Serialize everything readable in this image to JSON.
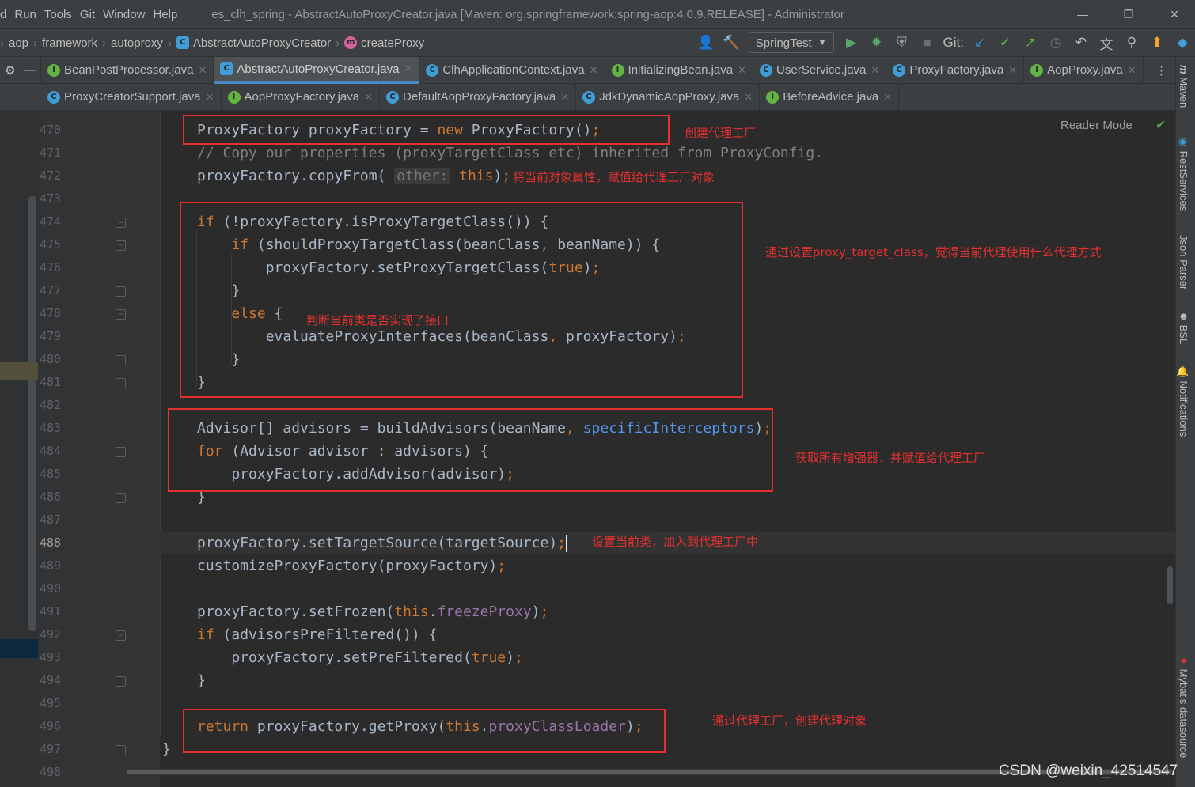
{
  "menu": {
    "items": [
      "d",
      "Run",
      "Tools",
      "Git",
      "Window",
      "Help"
    ],
    "title": "es_clh_spring - AbstractAutoProxyCreator.java [Maven: org.springframework:spring-aop:4.0.9.RELEASE] - Administrator"
  },
  "breadcrumb": {
    "items": [
      "aop",
      "framework",
      "autoproxy",
      "AbstractAutoProxyCreator",
      "createProxy"
    ]
  },
  "toolbar": {
    "run_config": "SpringTest",
    "git_label": "Git:"
  },
  "tabs_row1": [
    {
      "label": "BeanPostProcessor.java",
      "icon": "I"
    },
    {
      "label": "AbstractAutoProxyCreator.java",
      "icon": "C",
      "active": true
    },
    {
      "label": "ClhApplicationContext.java",
      "icon": "C"
    },
    {
      "label": "InitializingBean.java",
      "icon": "I"
    },
    {
      "label": "UserService.java",
      "icon": "C"
    },
    {
      "label": "ProxyFactory.java",
      "icon": "C"
    },
    {
      "label": "AopProxy.java",
      "icon": "I"
    }
  ],
  "tabs_row2": [
    {
      "label": "ProxyCreatorSupport.java",
      "icon": "C"
    },
    {
      "label": "AopProxyFactory.java",
      "icon": "I"
    },
    {
      "label": "DefaultAopProxyFactory.java",
      "icon": "C"
    },
    {
      "label": "JdkDynamicAopProxy.java",
      "icon": "C"
    },
    {
      "label": "BeforeAdvice.java",
      "icon": "I"
    }
  ],
  "editor": {
    "reader_mode": "Reader Mode",
    "line_numbers": [
      "470",
      "471",
      "472",
      "473",
      "474",
      "475",
      "476",
      "477",
      "478",
      "479",
      "480",
      "481",
      "482",
      "483",
      "484",
      "485",
      "486",
      "487",
      "488",
      "489",
      "490",
      "491",
      "492",
      "493",
      "494",
      "495",
      "496",
      "497",
      "498"
    ],
    "hint_other": "other:"
  },
  "annotations": {
    "n1": "创建代理工厂",
    "n2": "将当前对象属性，赋值给代理工厂对象",
    "n3": "通过设置proxy_target_class，觉得当前代理使用什么代理方式",
    "n4": "判断当前类是否实现了接口",
    "n5": "获取所有增强器，并赋值给代理工厂",
    "n6": "设置当前类，加入到代理工厂中",
    "n7": "通过代理工厂，创建代理对象"
  },
  "right_tools": [
    "Maven",
    "RestServices",
    "Json Parser",
    "BSL",
    "Notifications",
    "Mybatis datasource"
  ],
  "watermark": "CSDN @weixin_42514547",
  "colors": {
    "accent": "#4a88c7",
    "annotation_red": "#e5302f",
    "keyword": "#cc7832"
  }
}
